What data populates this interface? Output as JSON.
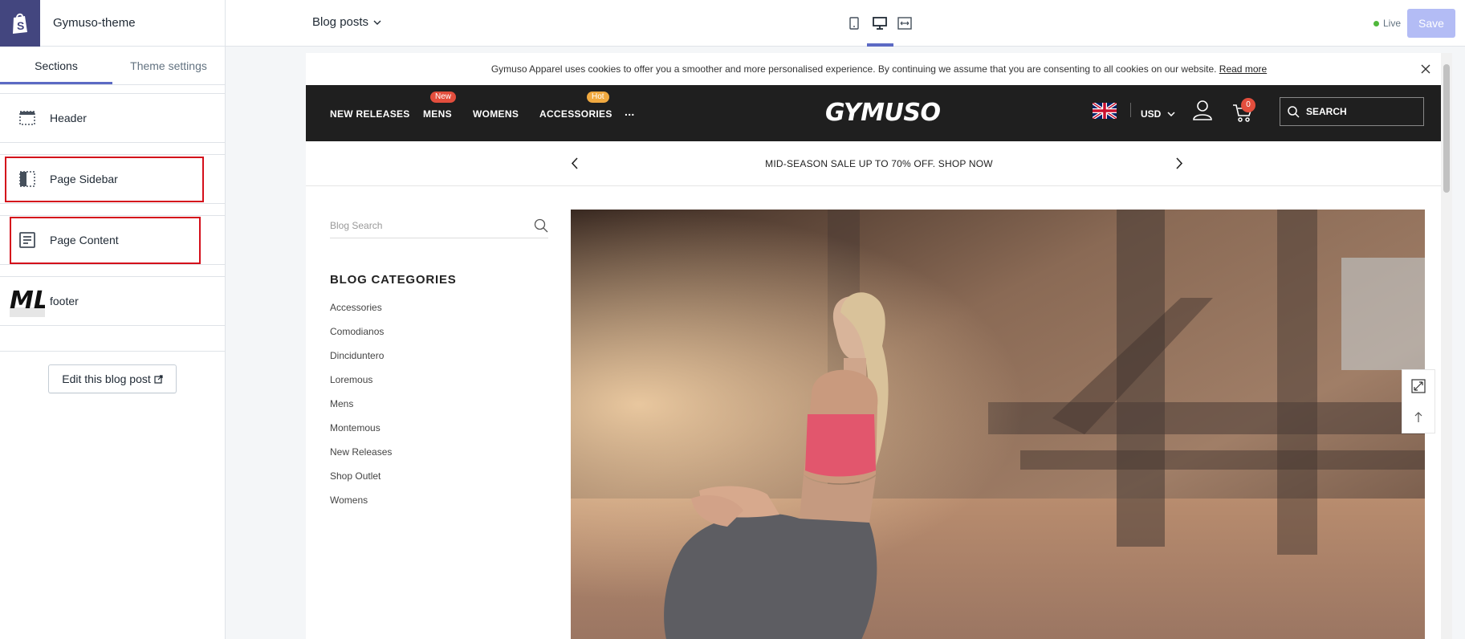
{
  "editor": {
    "theme_name": "Gymuso-theme",
    "tabs": [
      {
        "label": "Sections",
        "active": true
      },
      {
        "label": "Theme settings",
        "active": false
      }
    ],
    "sections": [
      {
        "label": "Header",
        "icon": "header-section-icon"
      },
      {
        "label": "Page Sidebar",
        "icon": "sidebar-section-icon"
      },
      {
        "label": "Page Content",
        "icon": "content-section-icon"
      },
      {
        "label": "footer",
        "icon": "footer-logo-icon",
        "logo_text": "ML"
      }
    ],
    "edit_post_label": "Edit this blog post"
  },
  "topbar": {
    "template": "Blog posts",
    "views": [
      "mobile-view-icon",
      "desktop-view-icon",
      "full-width-view-icon"
    ],
    "status": "Live",
    "save_label": "Save"
  },
  "colors": {
    "accent": "#5c6ac4",
    "highlight_box": "#d40f1b",
    "live_dot": "#50b83c",
    "nav_bg": "#1f1f1f",
    "badge_new": "#e34e3d",
    "badge_hot": "#f0a940"
  },
  "preview": {
    "cookie": {
      "text": "Gymuso Apparel uses cookies to offer you a smoother and more personalised experience. By continuing we assume that you are consenting to all cookies on our website.",
      "link": "Read more"
    },
    "nav": {
      "items": [
        {
          "label": "NEW RELEASES",
          "badge": ""
        },
        {
          "label": "MENS",
          "badge": "New"
        },
        {
          "label": "WOMENS",
          "badge": ""
        },
        {
          "label": "ACCESSORIES",
          "badge": "Hot"
        }
      ],
      "more": "...",
      "brand": "GYMUSO",
      "currency": "USD",
      "cart_count": "0",
      "search_label": "SEARCH"
    },
    "promo": "MID-SEASON SALE UP TO 70% OFF. SHOP NOW",
    "blog_search_placeholder": "Blog Search",
    "categories_title": "BLOG CATEGORIES",
    "categories": [
      "Accessories",
      "Comodianos",
      "Dinciduntero",
      "Loremous",
      "Mens",
      "Montemous",
      "New Releases",
      "Shop Outlet",
      "Womens"
    ]
  }
}
